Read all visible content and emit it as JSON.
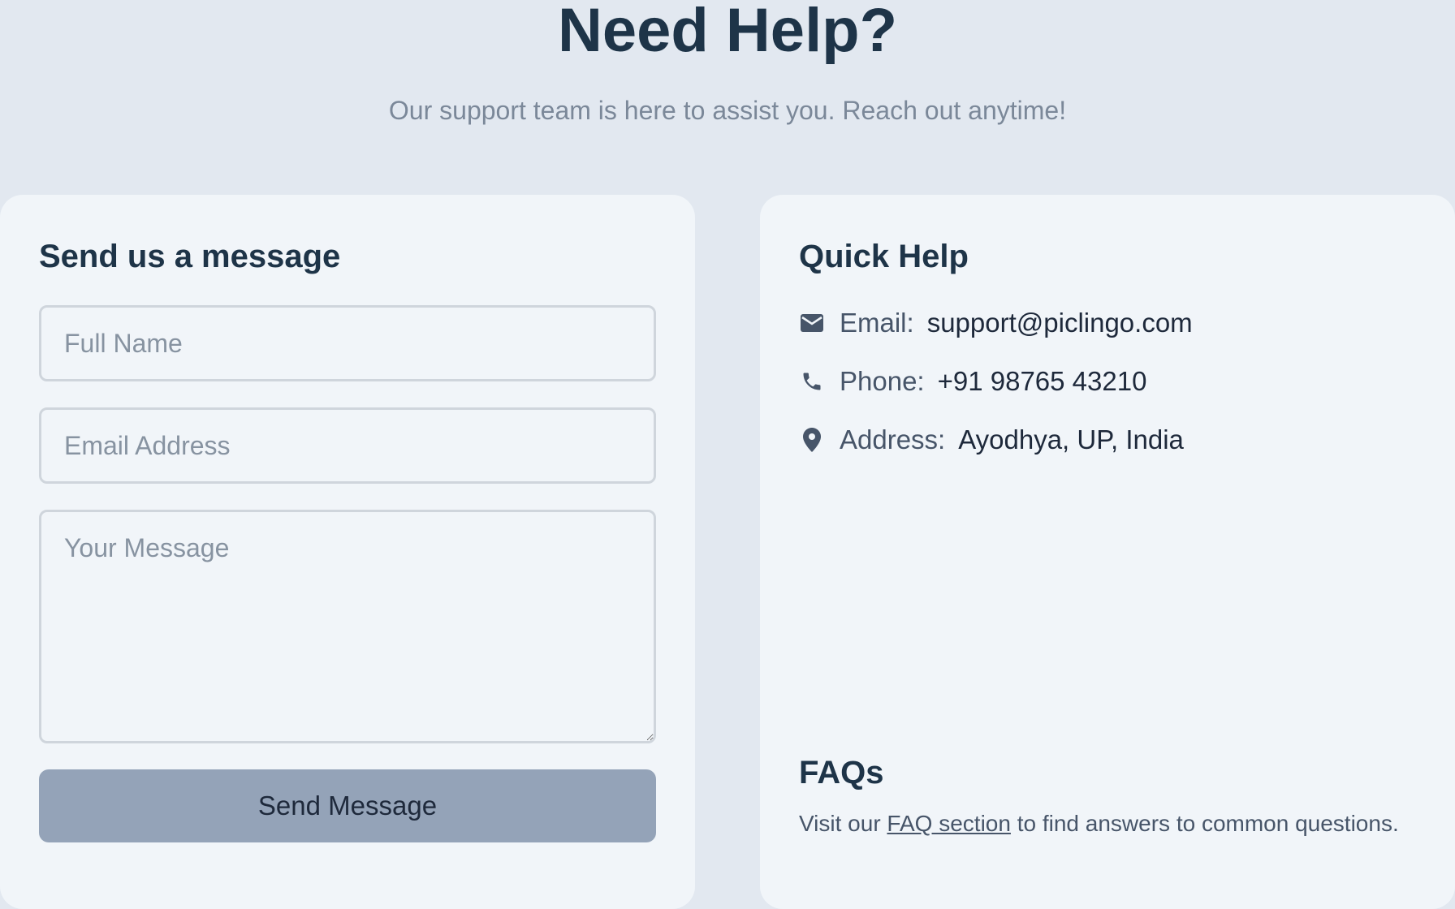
{
  "header": {
    "title": "Need Help?",
    "subtitle": "Our support team is here to assist you. Reach out anytime!"
  },
  "contact_form": {
    "title": "Send us a message",
    "full_name_placeholder": "Full Name",
    "email_placeholder": "Email Address",
    "message_placeholder": "Your Message",
    "submit_label": "Send Message"
  },
  "quick_help": {
    "title": "Quick Help",
    "items": [
      {
        "icon": "mail-icon",
        "label": "Email:",
        "value": "support@piclingo.com"
      },
      {
        "icon": "phone-icon",
        "label": "Phone:",
        "value": "+91 98765 43210"
      },
      {
        "icon": "location-pin-icon",
        "label": "Address:",
        "value": "Ayodhya, UP, India"
      }
    ]
  },
  "faqs": {
    "title": "FAQs",
    "text_before": "Visit our ",
    "link_label": "FAQ section",
    "text_after": " to find answers to common questions."
  }
}
